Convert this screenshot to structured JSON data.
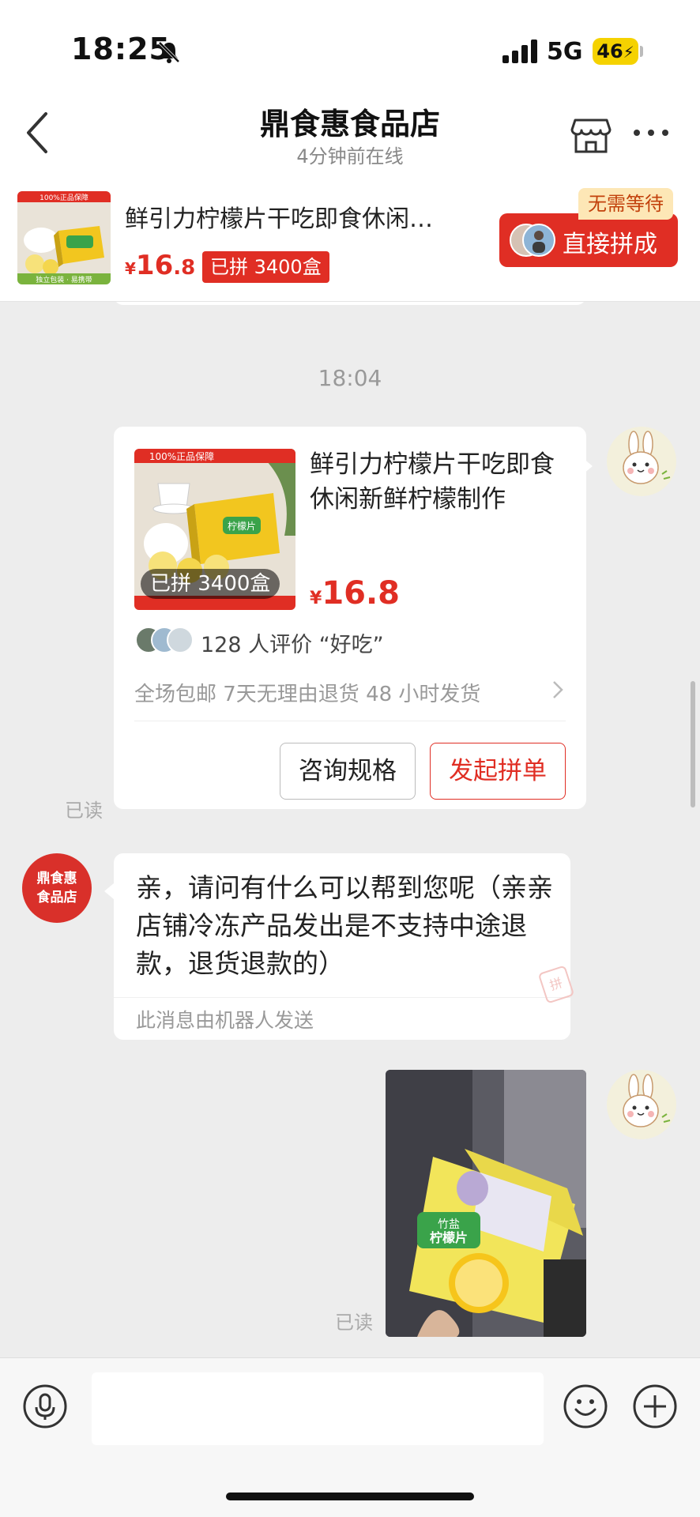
{
  "status_bar": {
    "time": "18:25",
    "network": "5G",
    "battery": "46",
    "icons": [
      "bell-slash-icon",
      "signal-icon",
      "battery-charging-icon"
    ]
  },
  "header": {
    "title": "鼎食惠食品店",
    "subtitle": "4分钟前在线",
    "icons": [
      "back-arrow-icon",
      "store-icon",
      "more-dots-icon"
    ]
  },
  "pinned_product": {
    "title": "鲜引力柠檬片干吃即食休闲…",
    "currency": "¥",
    "price_int": "16",
    "price_dec": ".8",
    "sold_badge": "已拼 3400盒",
    "no_wait_tag": "无需等待",
    "direct_button": "直接拼成",
    "image_caption_top": "100%正品保障",
    "image_caption_bottom": "独立包装 · 易携带"
  },
  "chat": {
    "timestamp": "18:04",
    "product_card": {
      "image_caption_top": "100%正品保障",
      "sold_badge": "已拼 3400盒",
      "title": "鲜引力柠檬片干吃即食休闲新鲜柠檬制作",
      "currency": "¥",
      "price": "16.8",
      "review_text": "128 人评价 “好吃”",
      "promises": "全场包邮  7天无理由退货  48 小时发货",
      "consult_button": "咨询规格",
      "group_button": "发起拼单",
      "read_status": "已读"
    },
    "shop_avatar_text": "鼎食惠\n食品店",
    "shop_message": {
      "text": "亲，请问有什么可以帮到您呢（亲亲店铺冷冻产品发出是不支持中途退款，退货退款的）",
      "note": "此消息由机器人发送",
      "stamp": "拼"
    },
    "photo": {
      "product_label": "竹盐\n柠檬片",
      "read_status": "已读"
    }
  },
  "input_bar": {
    "placeholder": "",
    "icons": [
      "microphone-icon",
      "emoji-icon",
      "plus-icon"
    ]
  },
  "colors": {
    "brand_red": "#e02e24",
    "chat_bg": "#ededed",
    "no_wait_bg": "#fde7b6"
  }
}
